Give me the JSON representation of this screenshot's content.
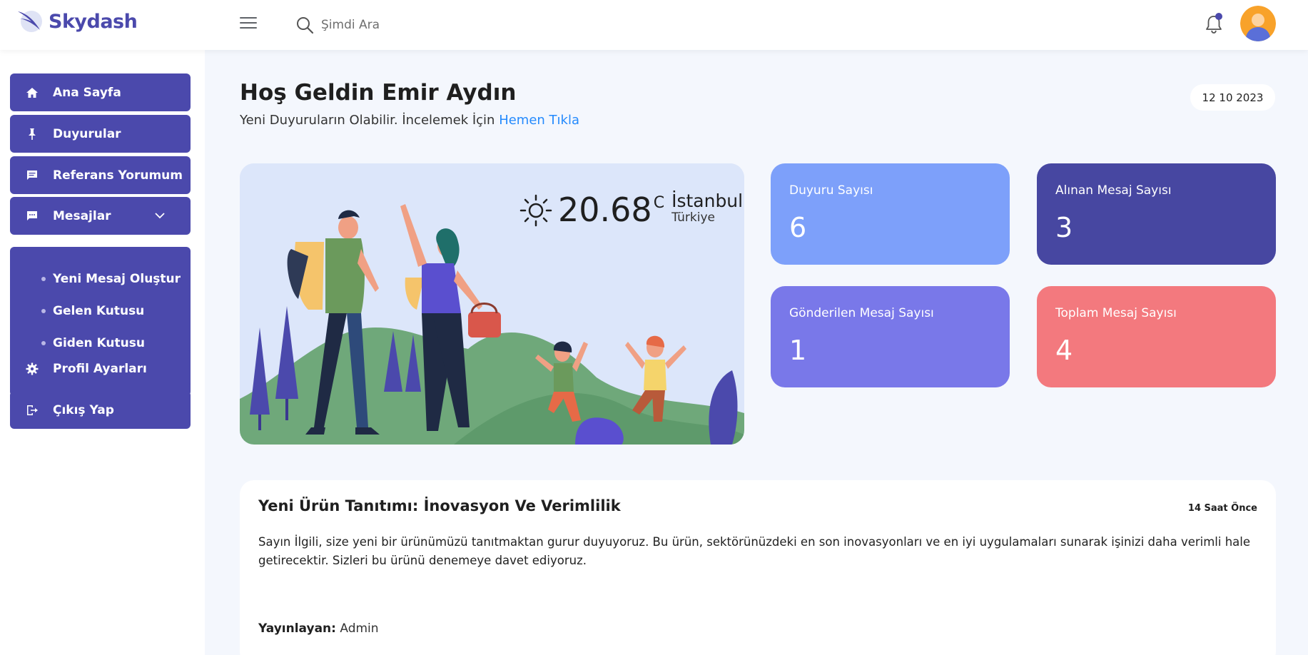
{
  "brand": {
    "name": "Skydash",
    "color": "#4b49ac"
  },
  "search": {
    "placeholder": "Şimdi Ara",
    "icon": "search-icon"
  },
  "sidebar": {
    "items": [
      {
        "label": "Ana Sayfa",
        "icon": "home-icon"
      },
      {
        "label": "Duyurular",
        "icon": "pin-icon"
      },
      {
        "label": "Referans Yorumum",
        "icon": "comment-icon"
      },
      {
        "label": "Mesajlar",
        "icon": "message-icon",
        "expanded": true,
        "subitems": [
          "Yeni Mesaj Oluştur",
          "Gelen Kutusu",
          "Giden Kutusu"
        ]
      },
      {
        "label": "Profil Ayarları",
        "icon": "gear-icon"
      },
      {
        "label": "Çıkış Yap",
        "icon": "logout-icon"
      }
    ]
  },
  "header": {
    "title": "Hoş Geldin Emir Aydın",
    "subtitle": "Yeni Duyuruların Olabilir. İncelemek İçin ",
    "link": "Hemen Tıkla",
    "date": "12 10 2023"
  },
  "weather": {
    "temp": "20.68",
    "unit": "C",
    "city": "İstanbul",
    "country": "Türkiye",
    "icon": "sun-icon"
  },
  "stats": [
    {
      "label": "Duyuru Sayısı",
      "value": "6",
      "color": "#7da0fa"
    },
    {
      "label": "Alınan Mesaj Sayısı",
      "value": "3",
      "color": "#4747a1"
    },
    {
      "label": "Gönderilen Mesaj Sayısı",
      "value": "1",
      "color": "#7978e9"
    },
    {
      "label": "Toplam Mesaj Sayısı",
      "value": "4",
      "color": "#f3797e"
    }
  ],
  "news": {
    "title": "Yeni Ürün Tanıtımı: İnovasyon Ve Verimlilik",
    "time": "14 Saat Önce",
    "body": "Sayın İlgili, size yeni bir ürünümüzü tanıtmaktan gurur duyuyoruz. Bu ürün, sektörünüzdeki en son inovasyonları ve en iyi uygulamaları sunarak işinizi daha verimli hale getirecektir. Sizleri bu ürünü denemeye davet ediyoruz.",
    "author_label": "Yayınlayan:",
    "author": "Admin"
  }
}
